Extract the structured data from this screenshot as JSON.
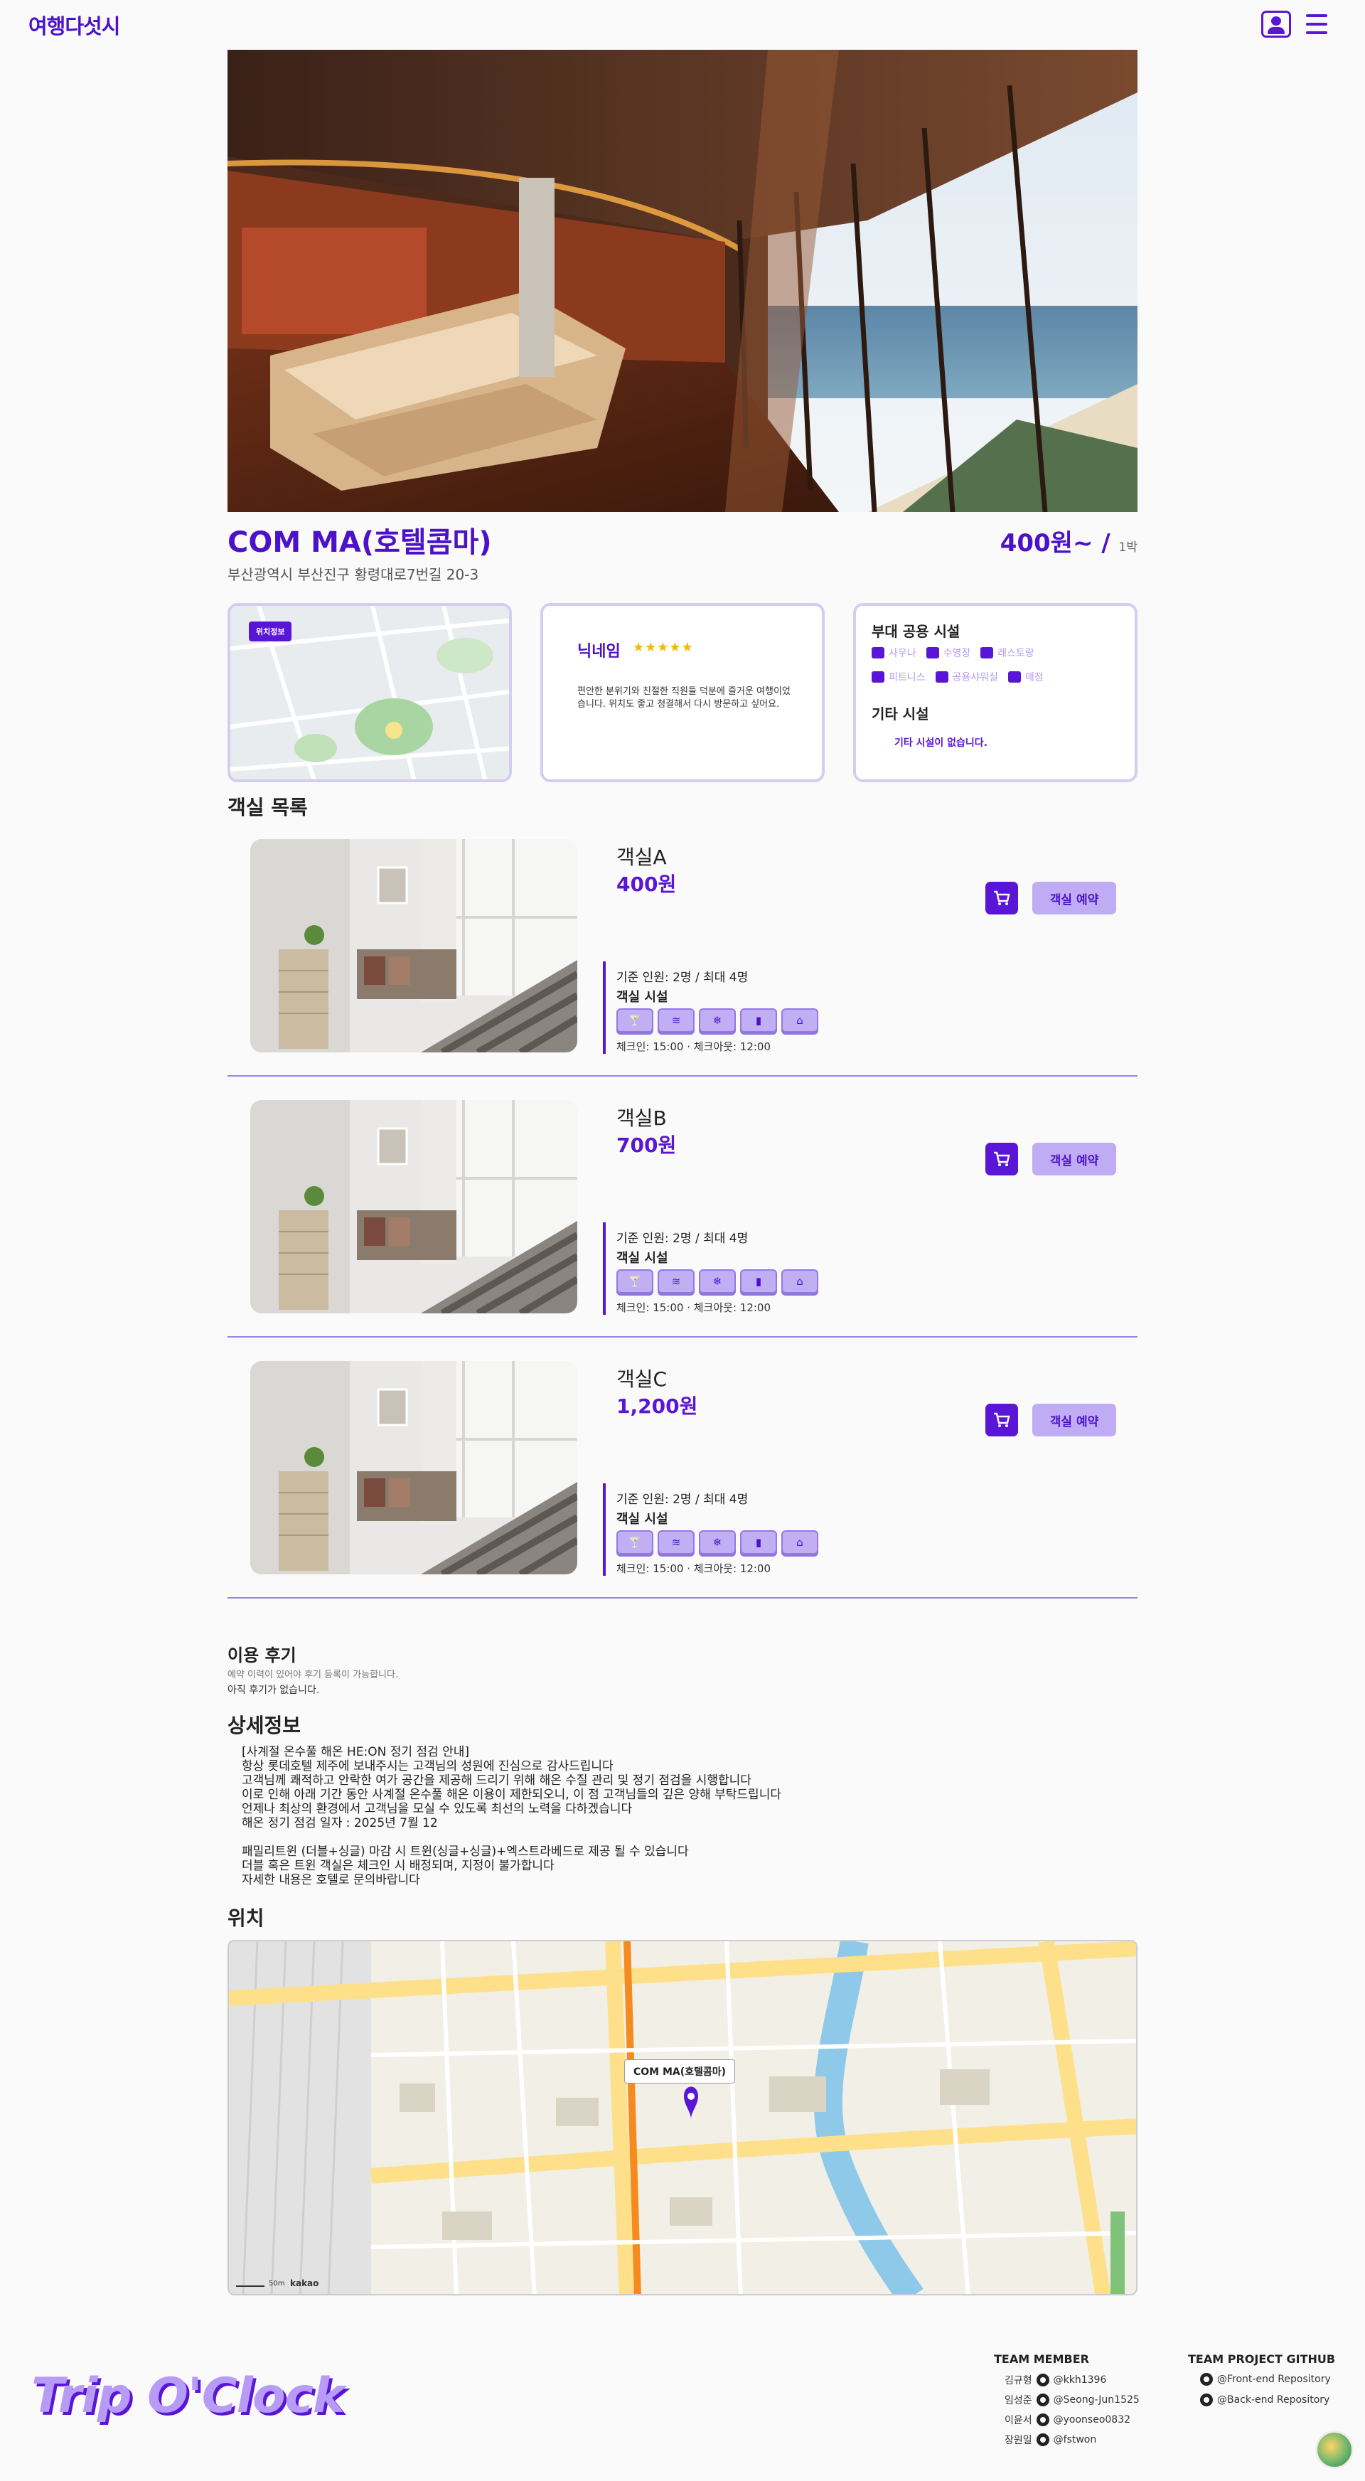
{
  "header": {
    "logo": "여행다섯시",
    "user_icon": "user-icon",
    "menu_icon": "hamburger-menu-icon"
  },
  "hotel": {
    "name": "COM MA(호텔콤마)",
    "address": "부산광역시 부산진구 황령대로7번길 20-3",
    "price": "400원~ /",
    "price_unit": "1박"
  },
  "map_card": {
    "badge": "위치정보"
  },
  "review_card": {
    "nickname": "닉네임",
    "stars": "★★★★★",
    "rating": 5,
    "text": "편안한 분위기와 친절한 직원들 덕분에 즐거운 여행이었습니다. 위치도 좋고 청결해서 다시 방문하고 싶어요."
  },
  "facilities": {
    "title": "부대 공용 시설",
    "items": [
      {
        "label": "사우나",
        "icon": "sauna-icon"
      },
      {
        "label": "수영장",
        "icon": "pool-icon"
      },
      {
        "label": "레스토랑",
        "icon": "restaurant-icon"
      },
      {
        "label": "피트니스",
        "icon": "fitness-icon"
      },
      {
        "label": "공용샤워실",
        "icon": "shower-icon"
      },
      {
        "label": "매점",
        "icon": "store-icon"
      }
    ],
    "etc_title": "기타 시설",
    "etc_none": "기타 시설이 없습니다."
  },
  "rooms_title": "객실 목록",
  "rooms": [
    {
      "name": "객실A",
      "price": "400원",
      "capacity": "기준 인원: 2명 / 최대 4명",
      "fac_title": "객실 시설",
      "check": "체크인: 15:00 · 체크아웃: 12:00",
      "book": "객실 예약"
    },
    {
      "name": "객실B",
      "price": "700원",
      "capacity": "기준 인원: 2명 / 최대 4명",
      "fac_title": "객실 시설",
      "check": "체크인: 15:00 · 체크아웃: 12:00",
      "book": "객실 예약"
    },
    {
      "name": "객실C",
      "price": "1,200원",
      "capacity": "기준 인원: 2명 / 최대 4명",
      "fac_title": "객실 시설",
      "check": "체크인: 15:00 · 체크아웃: 12:00",
      "book": "객실 예약"
    }
  ],
  "room_amenity_icons": [
    "bar-icon",
    "wifi-icon",
    "aircon-icon",
    "amenity-icon",
    "hairdryer-icon"
  ],
  "reviews": {
    "title": "이용 후기",
    "sub": "예약 이력이 있어야 후기 등록이 가능합니다.",
    "none": "아직 후기가 없습니다."
  },
  "detail": {
    "title": "상세정보",
    "text": "[사계절 온수풀 해온 HE:ON 정기 점검 안내]\n항상 롯데호텔 제주에 보내주시는 고객님의 성원에 진심으로 감사드립니다\n고객님께 쾌적하고 안락한 여가 공간을 제공해 드리기 위해 해온 수질 관리 및 정기 점검을 시행합니다\n이로 인해 아래 기간 동안 사계절 온수풀 해온 이용이 제한되오니, 이 점 고객님들의 깊은 양해 부탁드립니다\n언제나 최상의 환경에서 고객님을 모실 수 있도록 최선의 노력을 다하겠습니다\n해온 정기 점검 일자 : 2025년 7월 12\n\n패밀리트윈 (더블+싱글) 마감 시 트윈(싱글+싱글)+엑스트라베드로 제공 될 수 있습니다\n더블 혹은 트윈 객실은 체크인 시 배정되며, 지정이 불가합니다\n자세한 내용은 호텔로 문의바랍니다"
  },
  "location": {
    "title": "위치",
    "marker_label": "COM MA(호텔콤마)",
    "scale": "50m",
    "provider": "kakao"
  },
  "footer": {
    "logo": "Trip O'Clock",
    "team_title": "TEAM MEMBER",
    "members": [
      {
        "name": "김규형",
        "github": "@kkh1396"
      },
      {
        "name": "임성준",
        "github": "@Seong-Jun1525"
      },
      {
        "name": "이윤서",
        "github": "@yoonseo0832"
      },
      {
        "name": "장원일",
        "github": "@fstwon"
      }
    ],
    "repo_title": "TEAM PROJECT GITHUB",
    "repos": [
      "@Front-end Repository",
      "@Back-end Repository"
    ]
  }
}
